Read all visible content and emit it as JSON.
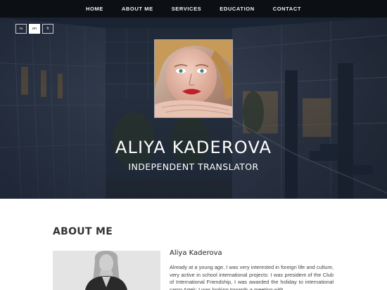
{
  "nav": {
    "items": [
      "HOME",
      "ABOUT ME",
      "SERVICES",
      "EDUCATION",
      "CONTACT"
    ]
  },
  "languages": {
    "items": [
      "ru",
      "en",
      "fr"
    ],
    "active": "en"
  },
  "hero": {
    "name": "ALIYA KADEROVA",
    "subtitle": "INDEPENDENT TRANSLATOR"
  },
  "about": {
    "section_title": "ABOUT ME",
    "name": "Aliya Kaderova",
    "text": "Already at a young age, I was very interested in foreign life and culture, very active in school international projects: I was president of the Club of International Friendship, I was awarded the holiday to international camp Artek; I was looking towards a meeting with"
  },
  "colors": {
    "navbar": "#0a0c10",
    "hero_overlay": "#141c2a",
    "text_dark": "#333333",
    "lip_red": "#c0202a"
  }
}
